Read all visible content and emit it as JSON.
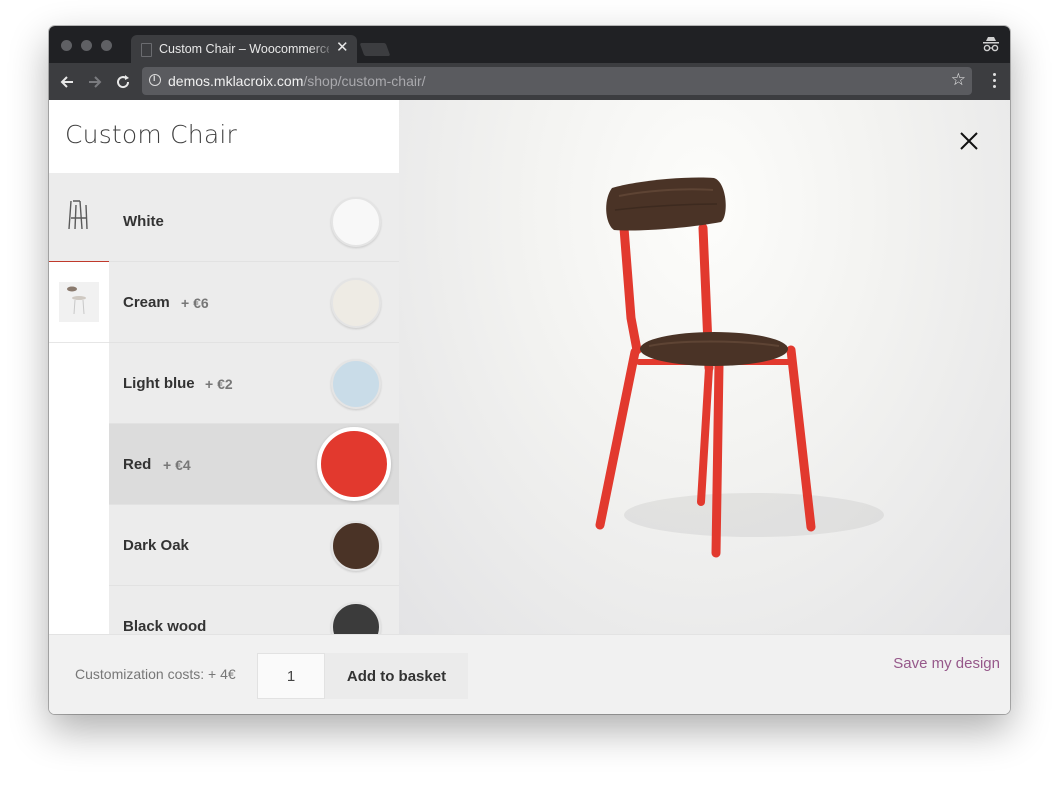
{
  "browser": {
    "tab_title": "Custom Chair – Woocommerce",
    "url_host": "demos.mklacroix.com",
    "url_path": "/shop/custom-chair/"
  },
  "product": {
    "title": "Custom Chair"
  },
  "options": [
    {
      "name": "White",
      "price": "",
      "color": "#f8f8f8",
      "selected": false
    },
    {
      "name": "Cream",
      "price": "+ €6",
      "color": "#eeebe4",
      "selected": false
    },
    {
      "name": "Light blue",
      "price": "+ €2",
      "color": "#c9dce8",
      "selected": false
    },
    {
      "name": "Red",
      "price": "+ €4",
      "color": "#e2392e",
      "selected": true
    },
    {
      "name": "Dark Oak",
      "price": "",
      "color": "#4a3326",
      "selected": false
    },
    {
      "name": "Black wood",
      "price": "",
      "color": "#3b3b3b",
      "selected": false
    }
  ],
  "footer": {
    "cost_label": "Customization costs: + 4€",
    "quantity": "1",
    "add_button": "Add to basket",
    "save_link": "Save my design"
  },
  "colors": {
    "accent_red": "#e2392e",
    "link_purple": "#96588a",
    "chair_wood": "#4a3326"
  },
  "icons": [
    "back-arrow-icon",
    "forward-arrow-icon",
    "reload-icon",
    "info-icon",
    "star-icon",
    "menu-icon",
    "incognito-icon",
    "close-icon",
    "chair-frame-icon",
    "chair-thumbnail-icon"
  ]
}
